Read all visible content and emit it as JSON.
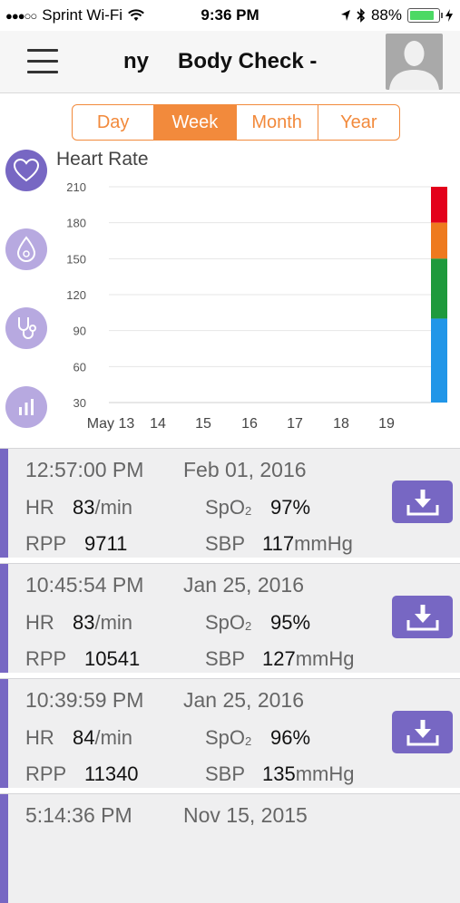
{
  "status": {
    "carrier": "Sprint Wi-Fi",
    "time": "9:36 PM",
    "battery": "88%",
    "battery_level": 0.88
  },
  "header": {
    "title_fragment": "ny",
    "title": "Body Check -"
  },
  "tabs": [
    {
      "label": "Day"
    },
    {
      "label": "Week",
      "active": true
    },
    {
      "label": "Month"
    },
    {
      "label": "Year"
    }
  ],
  "side_icons": [
    "heart-icon",
    "droplet-icon",
    "stethoscope-icon",
    "bar-chart-icon"
  ],
  "chart": {
    "title": "Heart Rate"
  },
  "chart_data": {
    "type": "line",
    "title": "Heart Rate",
    "x": [
      "May 13",
      "14",
      "15",
      "16",
      "17",
      "18",
      "19"
    ],
    "ylim": [
      30,
      210
    ],
    "yticks": [
      210,
      180,
      150,
      120,
      90,
      60,
      30
    ],
    "series": [],
    "grid": true,
    "color_scale": [
      {
        "from": 180,
        "to": 210,
        "color": "#e3001b"
      },
      {
        "from": 150,
        "to": 180,
        "color": "#ee7a1e"
      },
      {
        "from": 100,
        "to": 150,
        "color": "#1e9a3c"
      },
      {
        "from": 30,
        "to": 100,
        "color": "#2196e8"
      }
    ]
  },
  "records": [
    {
      "time": "12:57:00 PM",
      "date": "Feb 01, 2016",
      "hr_label": "HR",
      "hr": "83",
      "hr_unit": "/min",
      "spo2_label": "SpO",
      "spo2_sub": "2",
      "spo2": "97%",
      "rpp_label": "RPP",
      "rpp": "9711",
      "sbp_label": "SBP",
      "sbp": "117",
      "sbp_unit": "mmHg"
    },
    {
      "time": "10:45:54 PM",
      "date": "Jan 25, 2016",
      "hr_label": "HR",
      "hr": "83",
      "hr_unit": "/min",
      "spo2_label": "SpO",
      "spo2_sub": "2",
      "spo2": "95%",
      "rpp_label": "RPP",
      "rpp": "10541",
      "sbp_label": "SBP",
      "sbp": "127",
      "sbp_unit": "mmHg"
    },
    {
      "time": "10:39:59 PM",
      "date": "Jan 25, 2016",
      "hr_label": "HR",
      "hr": "84",
      "hr_unit": "/min",
      "spo2_label": "SpO",
      "spo2_sub": "2",
      "spo2": "96%",
      "rpp_label": "RPP",
      "rpp": "11340",
      "sbp_label": "SBP",
      "sbp": "135",
      "sbp_unit": "mmHg"
    },
    {
      "time": "5:14:36 PM",
      "date": "Nov 15, 2015"
    }
  ],
  "colors": {
    "accent": "#f28a3c",
    "purple": "#7767c3",
    "purple_light": "#b7a9e0"
  }
}
